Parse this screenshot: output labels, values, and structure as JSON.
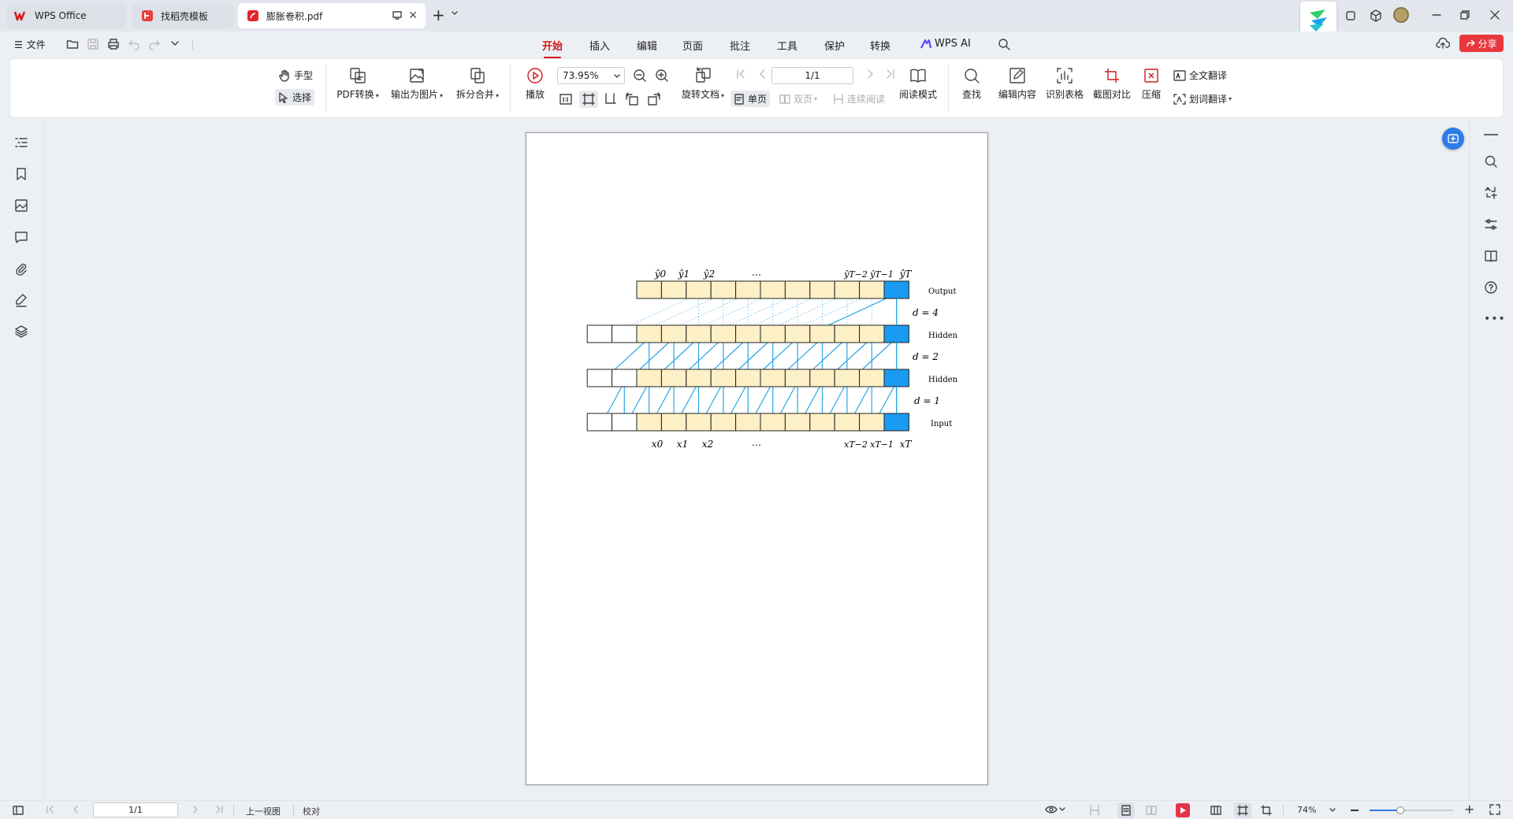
{
  "tabs": [
    {
      "label": "WPS Office"
    },
    {
      "label": "找稻壳模板"
    },
    {
      "label": "膨胀卷积.pdf"
    }
  ],
  "menu": {
    "file": "文件",
    "tabs": [
      "开始",
      "插入",
      "编辑",
      "页面",
      "批注",
      "工具",
      "保护",
      "转换"
    ],
    "ai": "WPS AI",
    "share": "分享"
  },
  "ribbon": {
    "hand": "手型",
    "select": "选择",
    "pdf_convert": "PDF转换",
    "export_image": "输出为图片",
    "split_merge": "拆分合并",
    "play": "播放",
    "zoom_value": "73.95%",
    "page_value": "1/1",
    "rotate": "旋转文档",
    "single": "单页",
    "double": "双页",
    "continuous": "连续阅读",
    "reading": "阅读模式",
    "find": "查找",
    "edit_content": "编辑内容",
    "recognize_table": "识别表格",
    "screenshot_compare": "截图对比",
    "compress": "压缩",
    "full_translate": "全文翻译",
    "word_translate": "划词翻译"
  },
  "diagram": {
    "output_labels": [
      "ŷ0",
      "ŷ1",
      "ŷ2",
      "…",
      "ŷT−2",
      "ŷT−1",
      "ŷT"
    ],
    "input_labels": [
      "x0",
      "x1",
      "x2",
      "…",
      "xT−2",
      "xT−1",
      "xT"
    ],
    "layer_names": [
      "Output",
      "Hidden",
      "Hidden",
      "Input"
    ],
    "dilations": [
      "d = 4",
      "d = 2",
      "d = 1"
    ]
  },
  "statusbar": {
    "page": "1/1",
    "prev_view": "上一视图",
    "proofread": "校对",
    "zoom": "74%"
  },
  "colors": {
    "accent": "#d11a1a",
    "cell_fill": "#fdf0c6",
    "highlight": "#1a9af0",
    "line": "#2aa6e6"
  }
}
